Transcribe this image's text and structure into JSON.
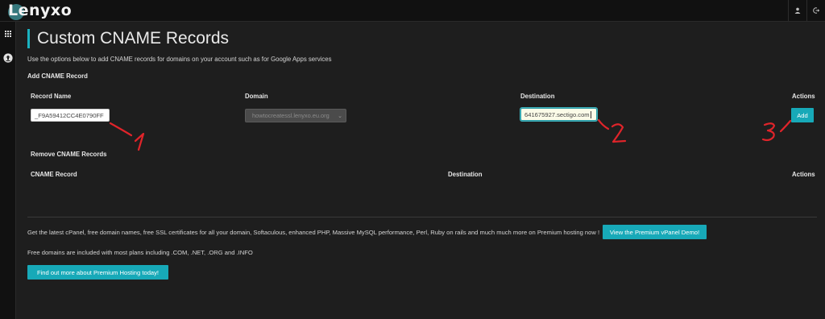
{
  "brand": {
    "name": "Lenyxo"
  },
  "topbar": {
    "icons": [
      "user-icon",
      "logout-icon"
    ]
  },
  "sidebar": {
    "icons": [
      "grid-icon",
      "upload-icon"
    ]
  },
  "page": {
    "title": "Custom CNAME Records",
    "description": "Use the options below to add CNAME records for domains on your account such as for Google Apps services"
  },
  "add_section": {
    "heading": "Add CNAME Record",
    "columns": {
      "record_name": "Record Name",
      "domain": "Domain",
      "destination": "Destination",
      "actions": "Actions"
    },
    "record_name_value": "_F9A59412CC4E0790FF",
    "domain_value": "howtocreatessl.lenyxo.eu.org",
    "destination_value": "641675927.sectigo.com",
    "add_label": "Add"
  },
  "remove_section": {
    "heading": "Remove CNAME Records",
    "columns": {
      "cname_record": "CNAME Record",
      "destination": "Destination",
      "actions": "Actions"
    }
  },
  "promo": {
    "text": "Get the latest cPanel, free domain names, free SSL certificates for all your domain, Softaculous, enhanced PHP, Massive MySQL performance, Perl, Ruby on rails and much much more on Premium hosting now !",
    "demo_button": "View the Premium vPanel Demo!",
    "free_domains": "Free domains are included with most plans including .COM, .NET, .ORG and .INFO",
    "find_out_button": "Find out more about Premium Hosting today!"
  },
  "annotations": [
    "1",
    "2",
    "3"
  ],
  "colors": {
    "accent": "#17a9b8",
    "annotation": "#e0242a",
    "background": "#1e1e1e"
  }
}
